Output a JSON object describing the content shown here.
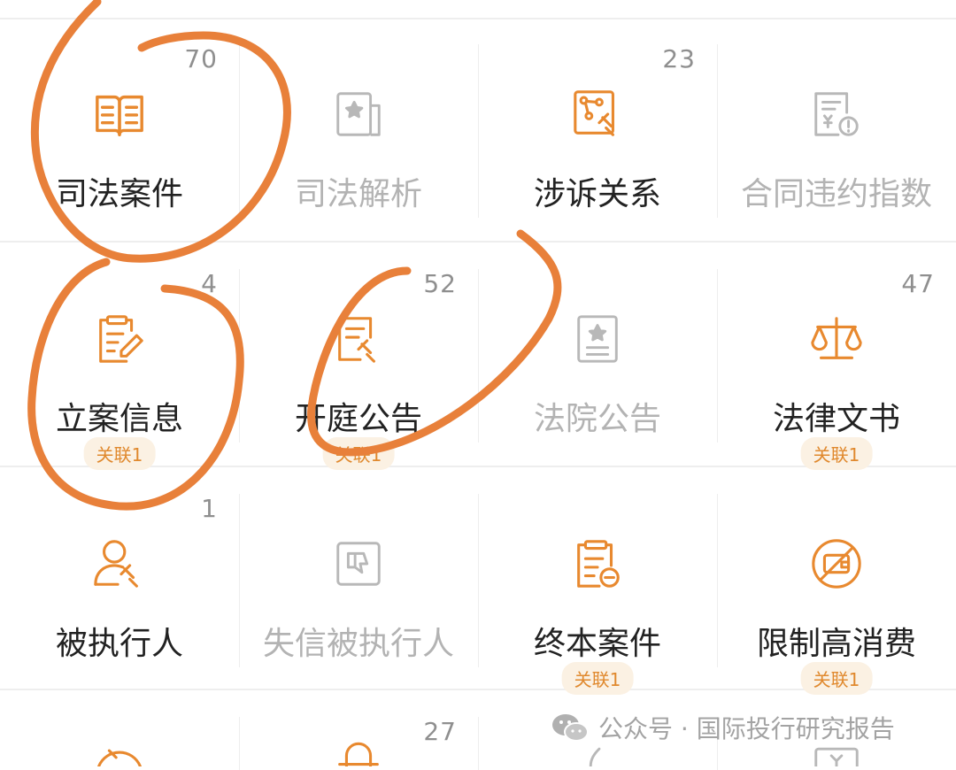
{
  "tiles": [
    {
      "label": "司法案件",
      "count": "70",
      "badge": null,
      "muted": false,
      "icon": "book-icon"
    },
    {
      "label": "司法解析",
      "count": "",
      "badge": null,
      "muted": true,
      "icon": "star-document-icon"
    },
    {
      "label": "涉诉关系",
      "count": "23",
      "badge": null,
      "muted": false,
      "icon": "relation-gavel-icon"
    },
    {
      "label": "合同违约指数",
      "count": "",
      "badge": null,
      "muted": true,
      "icon": "contract-warning-icon"
    },
    {
      "label": "立案信息",
      "count": "4",
      "badge": "关联1",
      "muted": false,
      "icon": "clipboard-pen-icon"
    },
    {
      "label": "开庭公告",
      "count": "52",
      "badge": "关联1",
      "muted": false,
      "icon": "document-gavel-icon"
    },
    {
      "label": "法院公告",
      "count": "",
      "badge": null,
      "muted": true,
      "icon": "star-certificate-icon"
    },
    {
      "label": "法律文书",
      "count": "47",
      "badge": "关联1",
      "muted": false,
      "icon": "scales-icon"
    },
    {
      "label": "被执行人",
      "count": "1",
      "badge": null,
      "muted": false,
      "icon": "person-gavel-icon"
    },
    {
      "label": "失信被执行人",
      "count": "",
      "badge": null,
      "muted": true,
      "icon": "thumbs-down-icon"
    },
    {
      "label": "终本案件",
      "count": "",
      "badge": "关联1",
      "muted": false,
      "icon": "clipboard-minus-icon"
    },
    {
      "label": "限制高消费",
      "count": "",
      "badge": "关联1",
      "muted": false,
      "icon": "wallet-restricted-icon"
    }
  ],
  "bottom_row": {
    "count_col2": "27"
  },
  "watermark": {
    "text": "公众号 · 国际投行研究报告",
    "icon": "wechat-icon"
  },
  "colors": {
    "accent": "#e8892f",
    "muted_icon": "#b8b8b8",
    "annotation": "#e8803a"
  }
}
